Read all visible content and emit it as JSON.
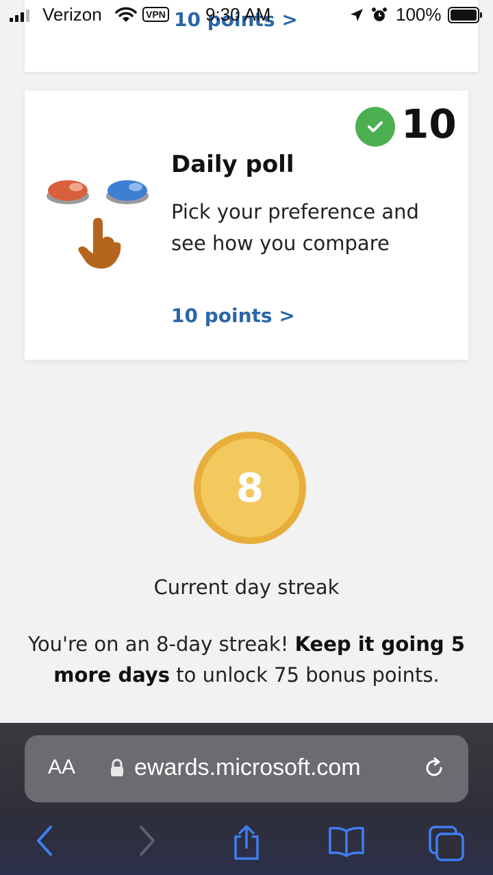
{
  "status_bar": {
    "carrier": "Verizon",
    "vpn_label": "VPN",
    "time": "9:30 AM",
    "battery_percent": "100%"
  },
  "previous_card": {
    "points_link": "10 points >"
  },
  "poll_card": {
    "earned_points": "10",
    "title": "Daily poll",
    "description": "Pick your preference and see how you compare",
    "points_link": "10 points >",
    "illustration": "two-buttons-pointing-hand"
  },
  "streak": {
    "days": "8",
    "label": "Current day streak",
    "message_part1": "You're on an 8-day streak! ",
    "message_bold": "Keep it going 5 more days",
    "message_part2": " to unlock 75 bonus points."
  },
  "browser": {
    "text_size_label": "AA",
    "url": "ewards.microsoft.com"
  },
  "colors": {
    "link": "#2a66a8",
    "check_badge": "#4caf50",
    "streak_fill": "#f3c95e",
    "streak_border": "#e8ae3c",
    "toolbar_icon": "#3f7ef0"
  },
  "icons": [
    "signal-icon",
    "wifi-icon",
    "location-arrow-icon",
    "alarm-icon",
    "battery-icon",
    "checkmark-icon",
    "lock-icon",
    "reload-icon",
    "back-icon",
    "forward-icon",
    "share-icon",
    "bookmarks-icon",
    "tabs-icon"
  ]
}
